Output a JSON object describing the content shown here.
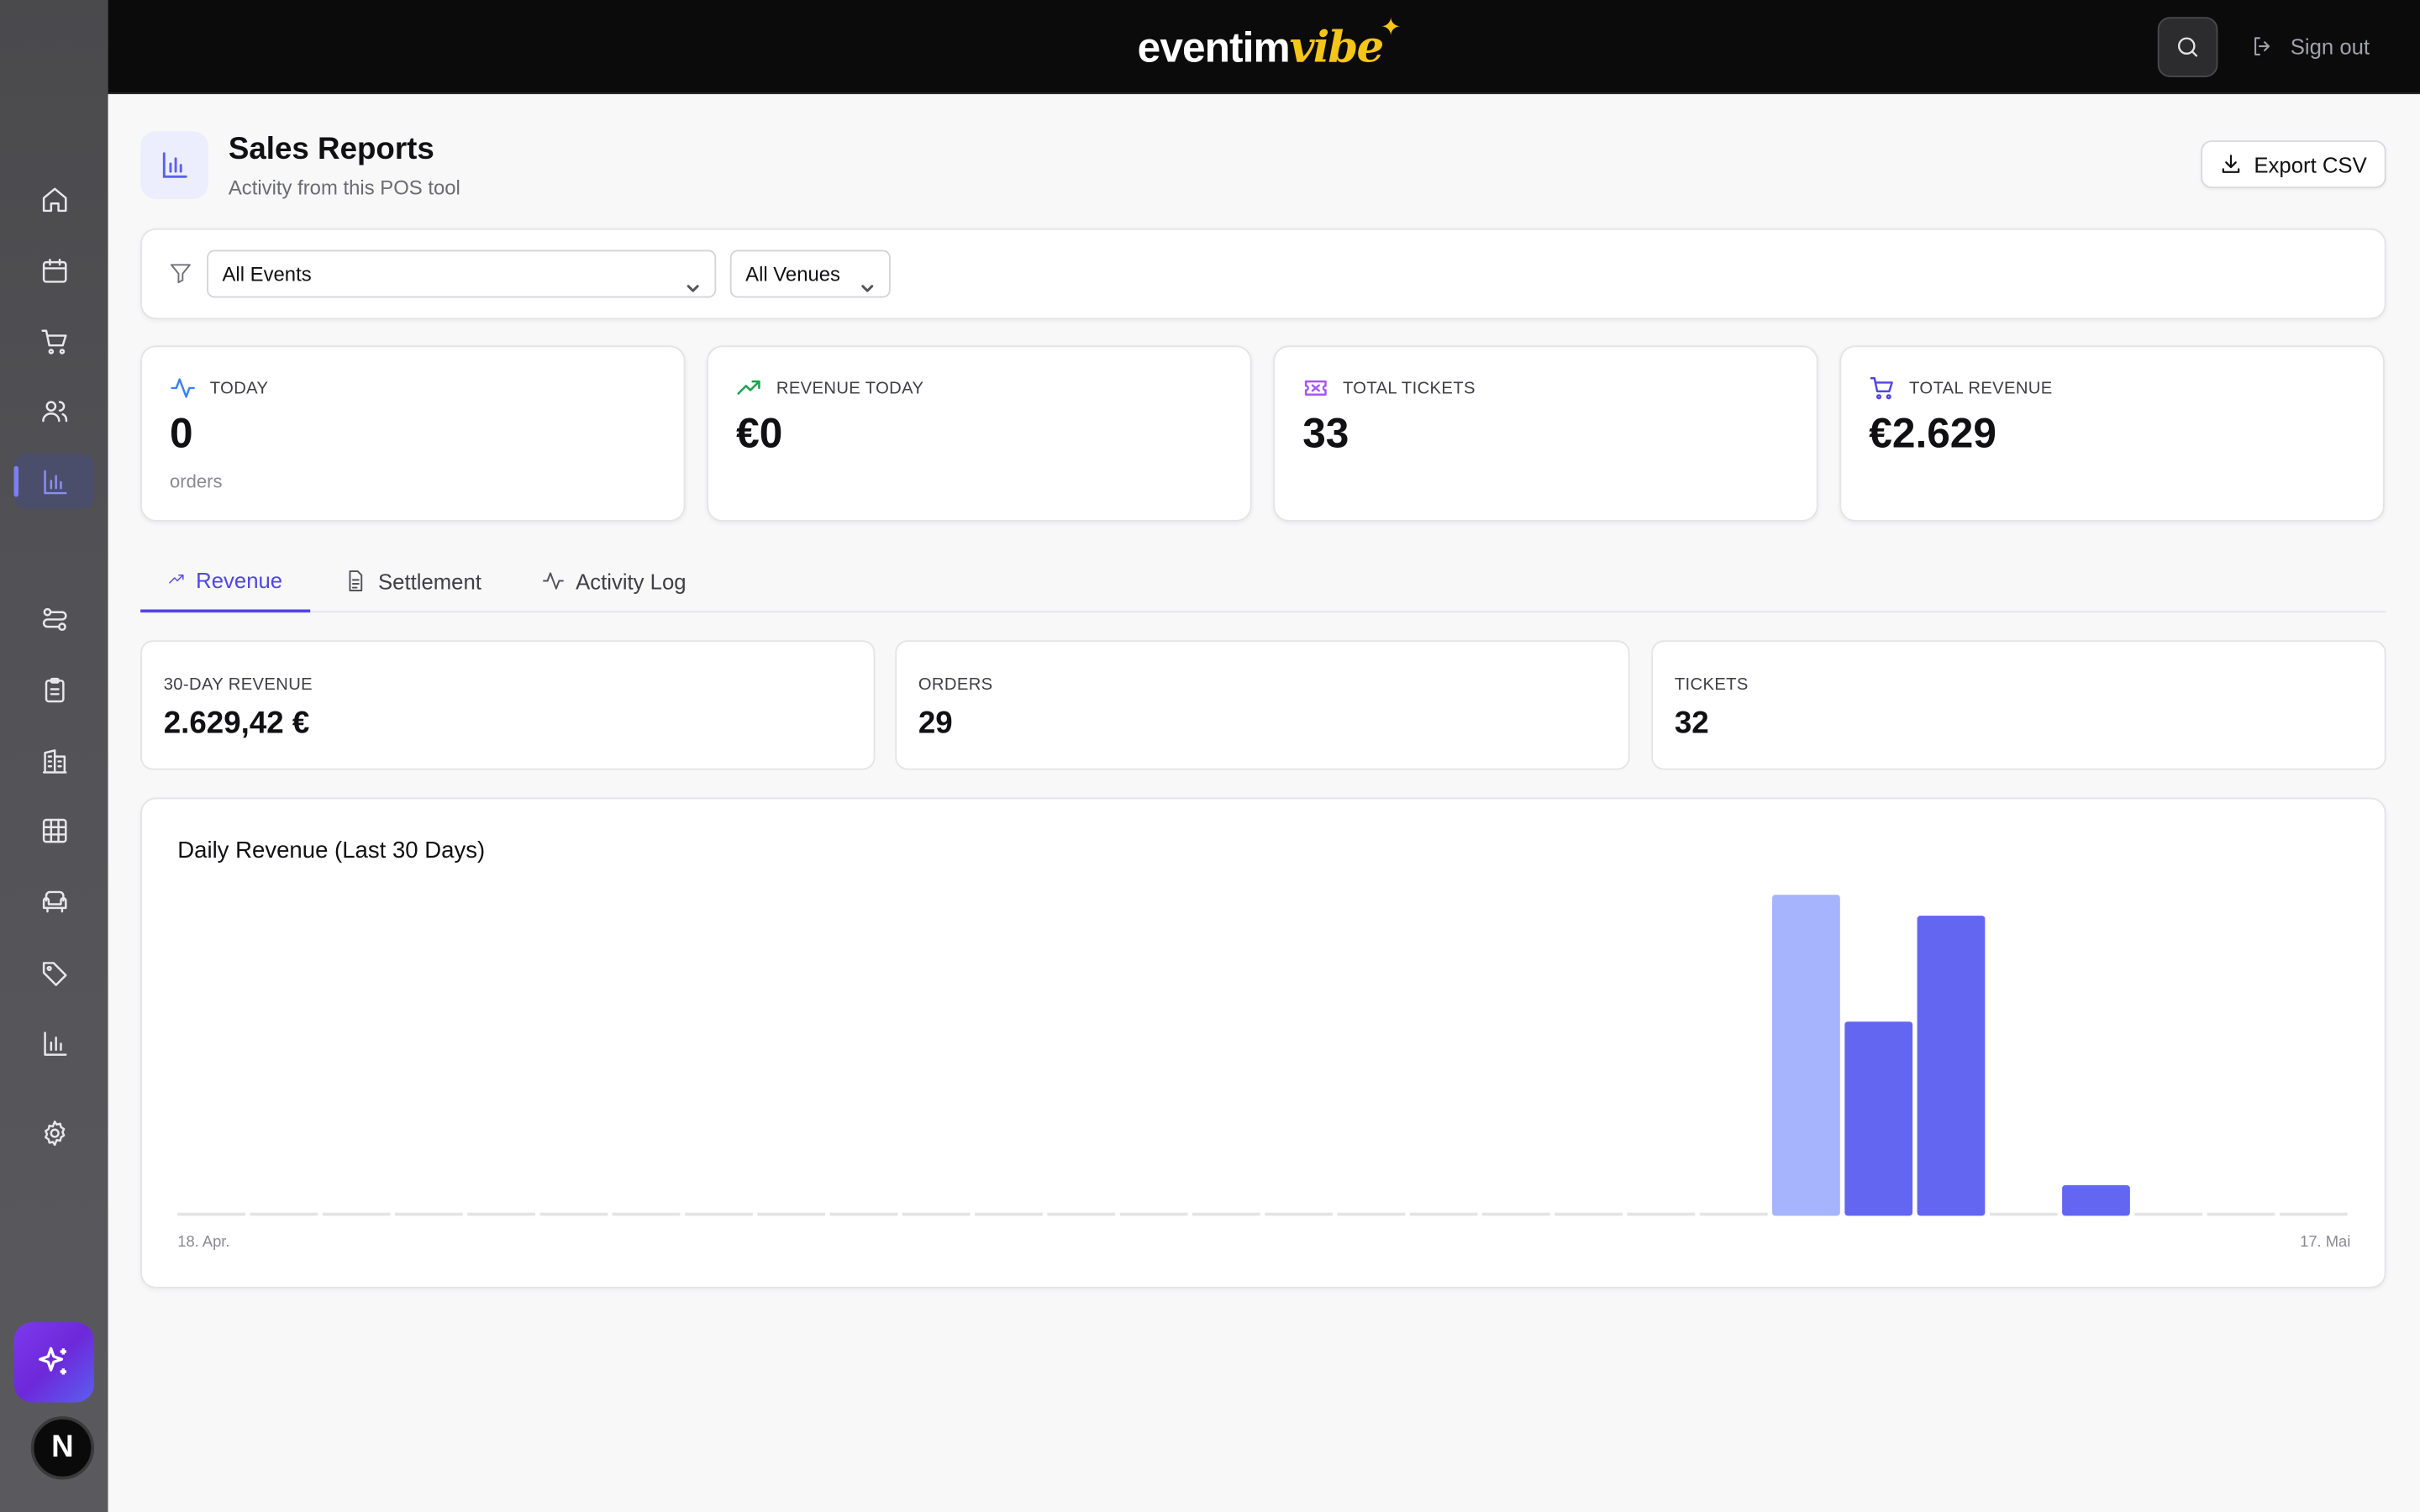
{
  "app": {
    "brand_primary": "eventim",
    "brand_accent": "vibe",
    "sign_out": "Sign out",
    "avatar_letter": "N"
  },
  "sidebar": {
    "items": [
      {
        "icon": "home-icon"
      },
      {
        "icon": "calendar-icon"
      },
      {
        "icon": "cart-icon"
      },
      {
        "icon": "users-icon"
      },
      {
        "icon": "bar-chart-icon",
        "active": true
      },
      {
        "icon": "routes-icon"
      },
      {
        "icon": "clipboard-icon"
      },
      {
        "icon": "building-icon"
      },
      {
        "icon": "grid-icon"
      },
      {
        "icon": "seat-icon"
      },
      {
        "icon": "tag-icon"
      },
      {
        "icon": "chart-icon"
      },
      {
        "icon": "settings-icon"
      }
    ]
  },
  "header": {
    "title": "Sales Reports",
    "subtitle": "Activity from this POS tool",
    "export_label": "Export CSV"
  },
  "filters": {
    "event": "All Events",
    "venue": "All Venues"
  },
  "stats": [
    {
      "label": "TODAY",
      "value": "0",
      "sub": "orders",
      "icon": "activity-icon",
      "color": "#3b82f6"
    },
    {
      "label": "REVENUE TODAY",
      "value": "€0",
      "sub": "",
      "icon": "trending-up-icon",
      "color": "#16a34a"
    },
    {
      "label": "TOTAL TICKETS",
      "value": "33",
      "sub": "",
      "icon": "ticket-icon",
      "color": "#a855f7"
    },
    {
      "label": "TOTAL REVENUE",
      "value": "€2.629",
      "sub": "",
      "icon": "cart-icon",
      "color": "#4f46e5"
    }
  ],
  "tabs": [
    {
      "label": "Revenue",
      "active": true
    },
    {
      "label": "Settlement"
    },
    {
      "label": "Activity Log"
    }
  ],
  "summary": [
    {
      "label": "30-DAY REVENUE",
      "value": "2.629,42 €"
    },
    {
      "label": "ORDERS",
      "value": "29"
    },
    {
      "label": "TICKETS",
      "value": "32"
    }
  ],
  "chart_data": {
    "type": "bar",
    "title": "Daily Revenue (Last 30 Days)",
    "x_start_label": "18. Apr.",
    "x_end_label": "17. Mai",
    "bar_color": "#6366f1",
    "highlight_color": "#a5b4fc",
    "values": [
      0,
      0,
      0,
      0,
      0,
      0,
      0,
      0,
      0,
      0,
      0,
      0,
      0,
      0,
      0,
      0,
      0,
      0,
      0,
      0,
      0,
      0,
      1000,
      605,
      935,
      0,
      95,
      0,
      0,
      0
    ]
  }
}
